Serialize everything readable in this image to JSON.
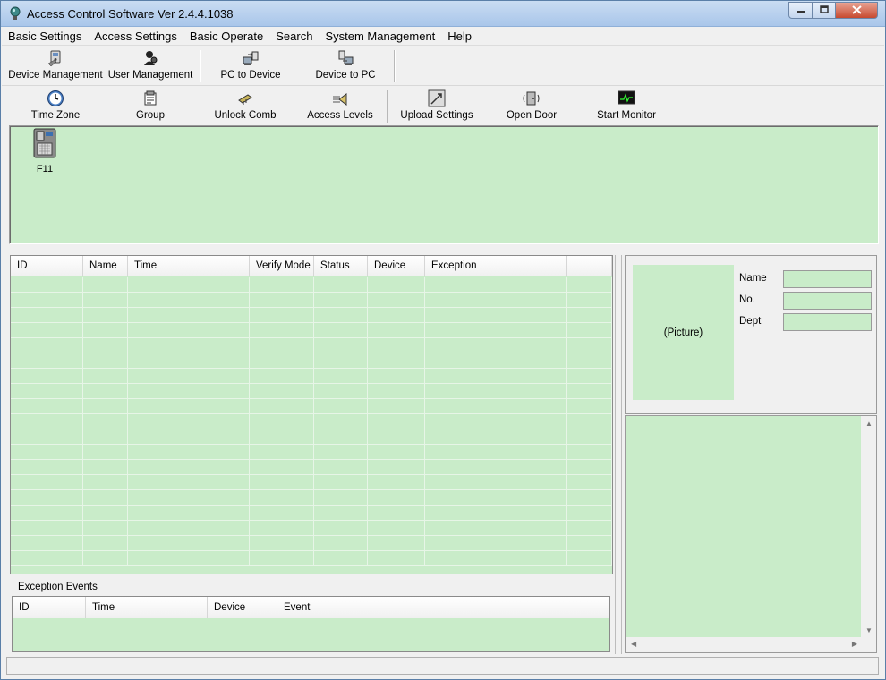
{
  "window": {
    "title": "Access Control Software  Ver 2.4.4.1038"
  },
  "menu": [
    "Basic Settings",
    "Access Settings",
    "Basic Operate",
    "Search",
    "System Management",
    "Help"
  ],
  "toolbar1": [
    {
      "label": "Device Management",
      "icon": "device-management-icon"
    },
    {
      "label": "User Management",
      "icon": "user-management-icon"
    },
    {
      "label": "PC to Device",
      "icon": "pc-to-device-icon"
    },
    {
      "label": "Device to PC",
      "icon": "device-to-pc-icon"
    }
  ],
  "toolbar2": [
    {
      "label": "Time Zone",
      "icon": "clock-icon"
    },
    {
      "label": "Group",
      "icon": "group-icon"
    },
    {
      "label": "Unlock Comb",
      "icon": "unlock-comb-icon"
    },
    {
      "label": "Access Levels",
      "icon": "access-levels-icon"
    },
    {
      "label": "Upload Settings",
      "icon": "upload-settings-icon"
    },
    {
      "label": "Open Door",
      "icon": "open-door-icon"
    },
    {
      "label": "Start Monitor",
      "icon": "monitor-icon"
    }
  ],
  "devices": [
    {
      "label": "F11",
      "icon": "fingerprint-terminal-icon"
    }
  ],
  "records": {
    "columns": [
      "ID",
      "Name",
      "Time",
      "Verify Mode",
      "Status",
      "Device",
      "Exception",
      ""
    ],
    "rows": []
  },
  "exception_events": {
    "label": "Exception Events",
    "columns": [
      "ID",
      "Time",
      "Device",
      "Event",
      ""
    ],
    "rows": []
  },
  "user_info": {
    "picture_placeholder": "(Picture)",
    "fields": [
      {
        "label": "Name",
        "value": ""
      },
      {
        "label": "No.",
        "value": ""
      },
      {
        "label": "Dept",
        "value": ""
      }
    ]
  },
  "colors": {
    "panel_green": "#c9ecc9",
    "window_bg": "#f0f0f0",
    "titlebar": "#b8d1ee"
  }
}
